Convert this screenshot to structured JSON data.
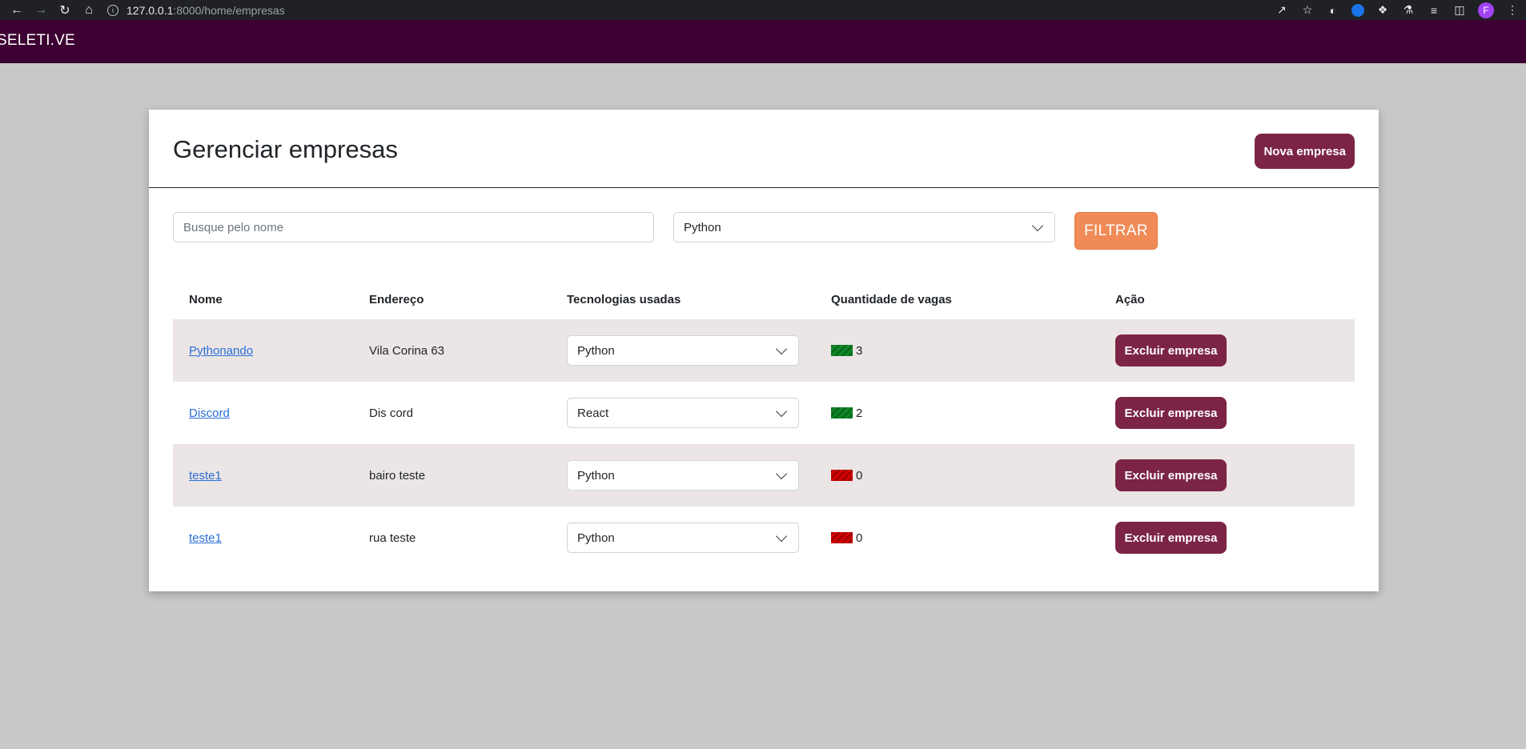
{
  "browser": {
    "url_host": "127.0.0.1",
    "url_path": ":8000/home/empresas",
    "profile_initial": "F"
  },
  "header": {
    "brand": "SELETI.VE"
  },
  "page": {
    "title": "Gerenciar empresas",
    "new_button": "Nova empresa"
  },
  "filters": {
    "search_placeholder": "Busque pelo nome",
    "tech_selected": "Python",
    "filter_button": "FILTRAR"
  },
  "table": {
    "headers": [
      "Nome",
      "Endereço",
      "Tecnologias usadas",
      "Quantidade de vagas",
      "Ação"
    ],
    "rows": [
      {
        "nome": "Pythonando",
        "endereco": "Vila Corina 63",
        "tecnologia": "Python",
        "vagas": "3",
        "status_color": "green",
        "acao": "Excluir empresa"
      },
      {
        "nome": "Discord",
        "endereco": "Dis cord",
        "tecnologia": "React",
        "vagas": "2",
        "status_color": "green",
        "acao": "Excluir empresa"
      },
      {
        "nome": "teste1",
        "endereco": "bairo teste",
        "tecnologia": "Python",
        "vagas": "0",
        "status_color": "red",
        "acao": "Excluir empresa"
      },
      {
        "nome": "teste1",
        "endereco": "rua teste",
        "tecnologia": "Python",
        "vagas": "0",
        "status_color": "red",
        "acao": "Excluir empresa"
      }
    ]
  },
  "colors": {
    "topbar": "#3c0032",
    "primary_button": "#7b2446",
    "filter_button": "#f08b57",
    "row_stripe": "#ebe5e5"
  }
}
